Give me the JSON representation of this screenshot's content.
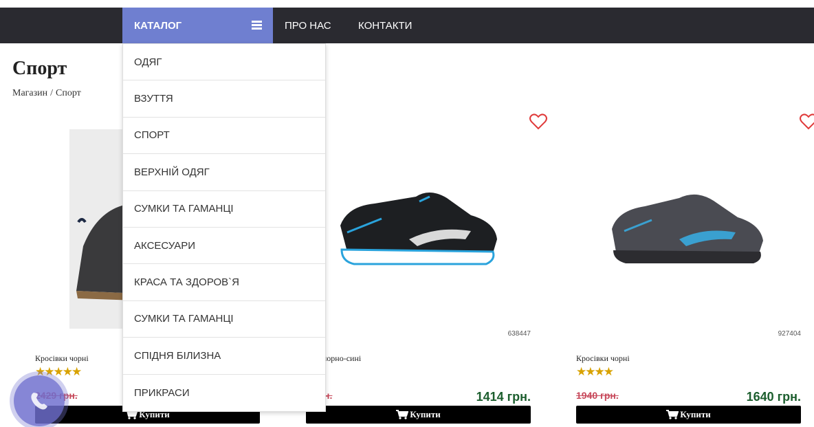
{
  "nav": {
    "catalog_label": "КАТАЛОГ",
    "links": [
      "ПРО НАС",
      "КОНТАКТИ"
    ]
  },
  "page": {
    "title": "Спорт",
    "breadcrumb": [
      "Магазин",
      "Спорт"
    ],
    "breadcrumb_separator": "/"
  },
  "dropdown": {
    "items": [
      "ОДЯГ",
      "ВЗУТТЯ",
      "СПОРТ",
      "ВЕРХНІЙ ОДЯГ",
      "СУМКИ ТА ГАМАНЦІ",
      "АКСЕСУАРИ",
      "КРАСА ТА ЗДОРОВ`Я",
      "СУМКИ ТА ГАМАНЦІ",
      "СПІДНЯ БІЛИЗНА",
      "ПРИКРАСИ"
    ]
  },
  "products": [
    {
      "name": "Кросівки чорні",
      "sku": "",
      "old_price": "2429 грн.",
      "price": "",
      "stars": "★★★★★",
      "buy_label": "Купити"
    },
    {
      "name": "івки чорно-сині",
      "sku": "638447",
      "old_price": "4 грн.",
      "price": "1414 грн.",
      "stars": "★★",
      "buy_label": "Купити"
    },
    {
      "name": "Кросівки чорні",
      "sku": "927404",
      "old_price": "1940 грн.",
      "price": "1640 грн.",
      "stars": "★★★★",
      "buy_label": "Купити"
    }
  ],
  "colors": {
    "topbar": "#2a2a30",
    "catalog_accent": "#6f7fd0",
    "price_green": "#1c5e2e",
    "old_price_red": "#c7485a",
    "star_gold": "#d8a200",
    "heart_red": "#e03a3a"
  },
  "icons": {
    "catalog": "list-icon",
    "favorite": "heart-icon",
    "buy": "cart-icon",
    "chat": "chat-icon"
  }
}
